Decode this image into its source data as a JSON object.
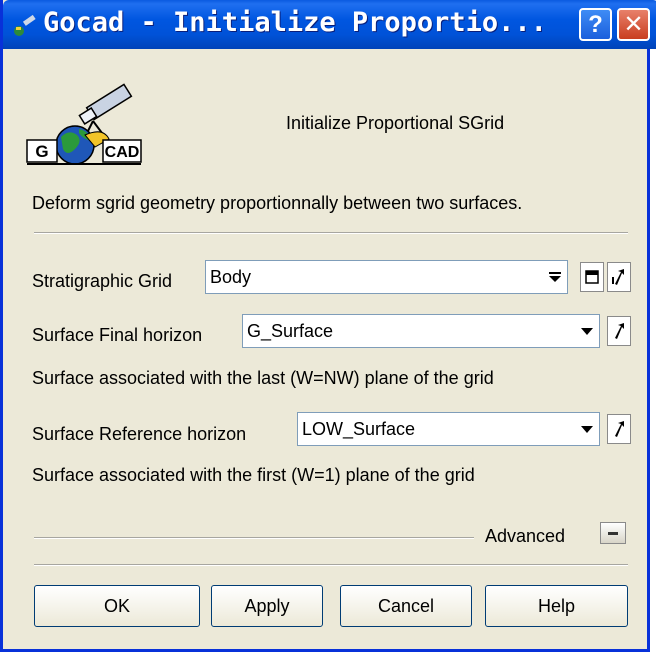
{
  "window": {
    "title": "Gocad - Initialize Proportio...",
    "help_glyph": "?",
    "close_glyph": "✕"
  },
  "logo": {
    "text_left": "G",
    "text_right": "CAD"
  },
  "dialog": {
    "heading": "Initialize Proportional SGrid",
    "description": "Deform sgrid geometry proportionnally between two surfaces."
  },
  "fields": {
    "stratigraphic_grid": {
      "label": "Stratigraphic Grid",
      "value": "Body"
    },
    "final_horizon": {
      "label": "Surface Final horizon",
      "value": "G_Surface",
      "help": "Surface associated with the last (W=NW) plane of the grid"
    },
    "reference_horizon": {
      "label": "Surface Reference horizon",
      "value": "LOW_Surface",
      "help": "Surface associated with the first (W=1) plane of the grid"
    }
  },
  "advanced": {
    "label": "Advanced"
  },
  "buttons": {
    "ok": "OK",
    "apply": "Apply",
    "cancel": "Cancel",
    "help": "Help"
  },
  "icons": {
    "dropdown": "chevron-down-icon",
    "pick": "pick-arrow-icon",
    "window_list": "window-icon",
    "expand": "expand-icon"
  }
}
